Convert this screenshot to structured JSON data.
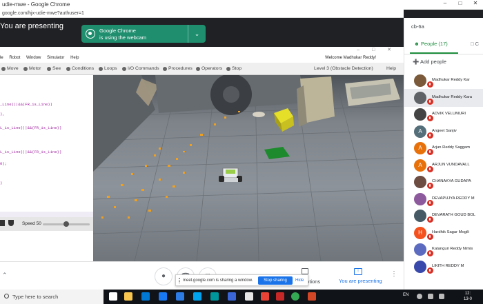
{
  "browser": {
    "title": "udie-mwe - Google Chrome",
    "url": "google.com/hjx-udie-mwe?authuser=1",
    "window_controls": [
      "–",
      "□",
      "✕"
    ]
  },
  "meet_banner": {
    "presenting": "You are presenting",
    "webcam_line1": "Google Chrome",
    "webcam_line2": "is using the webcam"
  },
  "app": {
    "menu": [
      "le",
      "Robot",
      "Window",
      "Simulator",
      "Help"
    ],
    "welcome": "Welcome Madhukar Reddy!",
    "toolbar": [
      "Move",
      "Motor",
      "See",
      "Conditions",
      "Loops",
      "I/O Commands",
      "Procedures",
      "Operators",
      "Stop"
    ],
    "level": "Level 3 (Obstacle Detection)",
    "help": "Help",
    "code_lines": [
      "_Line)||&&(FR_is_Line))",
      "),",
      "L_is_Line)||&&(FR_is_Line))",
      "",
      "L_is_Line)||&&(FR_is_Line))",
      "0);",
      "",
      ")"
    ],
    "speed_label": "Speed 50",
    "speed_value": 50
  },
  "meet_controls": {
    "captions": "aptions",
    "you_are_presenting": "You are presenting",
    "share_msg": "meet.google.com is sharing a window.",
    "stop_sharing": "Stop sharing",
    "hide": "Hide"
  },
  "people_panel": {
    "meeting_code": "cb-6a",
    "people_tab": "People (17)",
    "chat_tab": "C",
    "add_people": "Add people",
    "participants": [
      {
        "name": "Madhukar Reddy Kar",
        "initial": "",
        "color": "#7a5a3a"
      },
      {
        "name": "Madhukar Reddy Kara",
        "initial": "",
        "color": "#5f6368"
      },
      {
        "name": "ADVIK VELUMURI",
        "initial": "",
        "color": "#444"
      },
      {
        "name": "Angeet Sanjiv",
        "initial": "A",
        "color": "#546e7a"
      },
      {
        "name": "Arjun Reddy Saggam",
        "initial": "A",
        "color": "#e8710a"
      },
      {
        "name": "ARJUN VUNDAVALL",
        "initial": "A",
        "color": "#e8710a"
      },
      {
        "name": "CHANAKYA GUDAPA",
        "initial": "",
        "color": "#6d4c41"
      },
      {
        "name": "DEVAPUJYA REDDY M",
        "initial": "",
        "color": "#8e5a9e"
      },
      {
        "name": "DEVARATH GOUD BOL",
        "initial": "",
        "color": "#455a64"
      },
      {
        "name": "Hardhik Sagar Mogili",
        "initial": "H",
        "color": "#f4511e"
      },
      {
        "name": "Katanguri Reddy Nimis",
        "initial": "",
        "color": "#5c6bc0"
      },
      {
        "name": "LIKITH REDDY M",
        "initial": "",
        "color": "#3949ab"
      }
    ]
  },
  "taskbar": {
    "search_placeholder": "Type here to search",
    "lang": "EN",
    "time": "12:",
    "date": "13-0"
  }
}
